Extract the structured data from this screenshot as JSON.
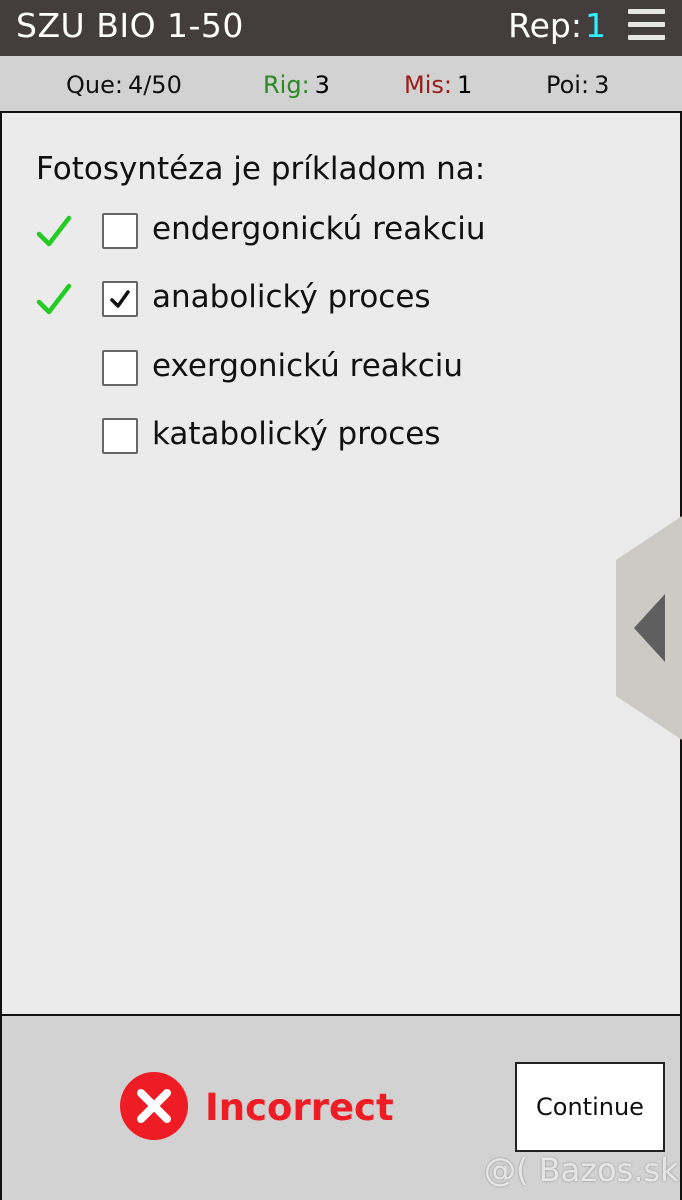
{
  "appbar": {
    "title": "SZU BIO 1-50",
    "rep_label": "Rep:",
    "rep_value": "1",
    "menu_icon": "hamburger-menu-icon"
  },
  "stats": {
    "que_label": "Que:",
    "que_value": "4/50",
    "rig_label": "Rig:",
    "rig_value": "3",
    "mis_label": "Mis:",
    "mis_value": "1",
    "poi_label": "Poi:",
    "poi_value": "3"
  },
  "question": {
    "text": "Fotosyntéza je príkladom na:",
    "answers": [
      {
        "text": "endergonickú reakciu",
        "checked": false,
        "correct": true
      },
      {
        "text": "anabolický proces",
        "checked": true,
        "correct": true
      },
      {
        "text": "exergonickú reakciu",
        "checked": false,
        "correct": false
      },
      {
        "text": "katabolický proces",
        "checked": false,
        "correct": false
      }
    ]
  },
  "side_tab_icon": "triangle-left-icon",
  "footer": {
    "status_icon": "x-circle-icon",
    "result": "Incorrect",
    "continue_label": "Continue"
  },
  "watermark": "@( Bazos.sk",
  "colors": {
    "appbar": "#433d3d",
    "rep_value": "#2ff0ff",
    "rig_label": "#2c8a25",
    "mis_label": "#9b1a1a",
    "correct_check": "#22cc22",
    "incorrect": "#ee1c24"
  }
}
